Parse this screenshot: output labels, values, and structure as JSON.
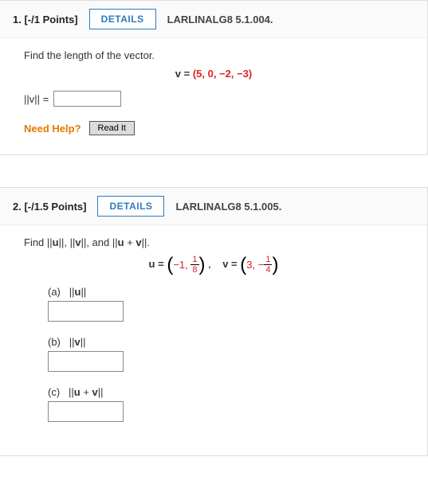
{
  "q1": {
    "number": "1.",
    "points": "[-/1 Points]",
    "details": "DETAILS",
    "ref": "LARLINALG8 5.1.004.",
    "prompt": "Find the length of the vector.",
    "eq_label": "v =",
    "vector": "(5, 0, −2, −3)",
    "norm_label": "||v||  =",
    "need_help": "Need Help?",
    "readit": "Read It"
  },
  "q2": {
    "number": "2.",
    "points": "[-/1.5 Points]",
    "details": "DETAILS",
    "ref": "LARLINALG8 5.1.005.",
    "prompt": "Find ||u||, ||v||, and ||u + v||.",
    "u_prefix": "u =",
    "u_first": "−1,",
    "u_num": "1",
    "u_den": "8",
    "v_prefix": "v =",
    "v_first": "3,",
    "v_minus": "−",
    "v_num": "1",
    "v_den": "4",
    "parts": {
      "a": {
        "label": "(a)",
        "expr": "||u||"
      },
      "b": {
        "label": "(b)",
        "expr": "||v||"
      },
      "c": {
        "label": "(c)",
        "expr": "||u + v||"
      }
    }
  }
}
